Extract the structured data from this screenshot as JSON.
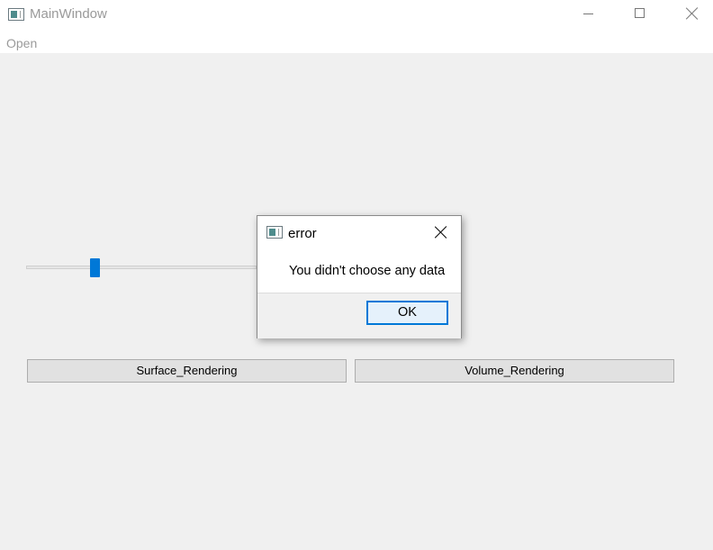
{
  "window": {
    "title": "MainWindow",
    "app_icon": "window-app-icon",
    "caption_icons": [
      "minimize-icon",
      "maximize-icon",
      "close-icon"
    ]
  },
  "menubar": {
    "items": [
      {
        "label": "Open"
      }
    ]
  },
  "slider": {
    "value_fraction": 0.29,
    "accent_color": "#0078d7"
  },
  "buttons": {
    "surface_label": "Surface_Rendering",
    "volume_label": "Volume_Rendering"
  },
  "dialog": {
    "title": "error",
    "message": "You didn't choose any data",
    "ok_label": "OK",
    "icons": [
      "window-app-icon",
      "close-icon"
    ]
  }
}
